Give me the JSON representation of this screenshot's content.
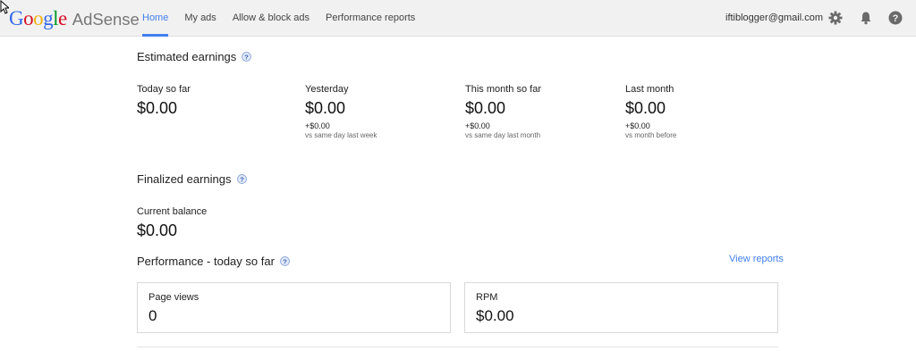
{
  "brand": {
    "google": "Google",
    "product": "AdSense"
  },
  "nav": [
    {
      "label": "Home",
      "active": true
    },
    {
      "label": "My ads",
      "active": false
    },
    {
      "label": "Allow & block ads",
      "active": false
    },
    {
      "label": "Performance reports",
      "active": false
    }
  ],
  "account": {
    "email": "iftiblogger@gmail.com"
  },
  "icons": {
    "settings": "gear-icon",
    "notifications": "bell-icon",
    "help": "help-icon"
  },
  "estimated": {
    "title": "Estimated earnings",
    "items": [
      {
        "label": "Today so far",
        "value": "$0.00",
        "delta": "",
        "comparison": ""
      },
      {
        "label": "Yesterday",
        "value": "$0.00",
        "delta": "+$0.00",
        "comparison": "vs same day last week"
      },
      {
        "label": "This month so far",
        "value": "$0.00",
        "delta": "+$0.00",
        "comparison": "vs same day last month"
      },
      {
        "label": "Last month",
        "value": "$0.00",
        "delta": "+$0.00",
        "comparison": "vs month before"
      }
    ]
  },
  "finalized": {
    "title": "Finalized earnings",
    "balance_label": "Current balance",
    "balance_value": "$0.00"
  },
  "performance": {
    "title": "Performance - today so far",
    "view_reports": "View reports",
    "cards": [
      {
        "label": "Page views",
        "value": "0"
      },
      {
        "label": "RPM",
        "value": "$0.00"
      }
    ]
  },
  "colors": {
    "accent": "#427fed",
    "topbar": "#f1f1f1"
  }
}
